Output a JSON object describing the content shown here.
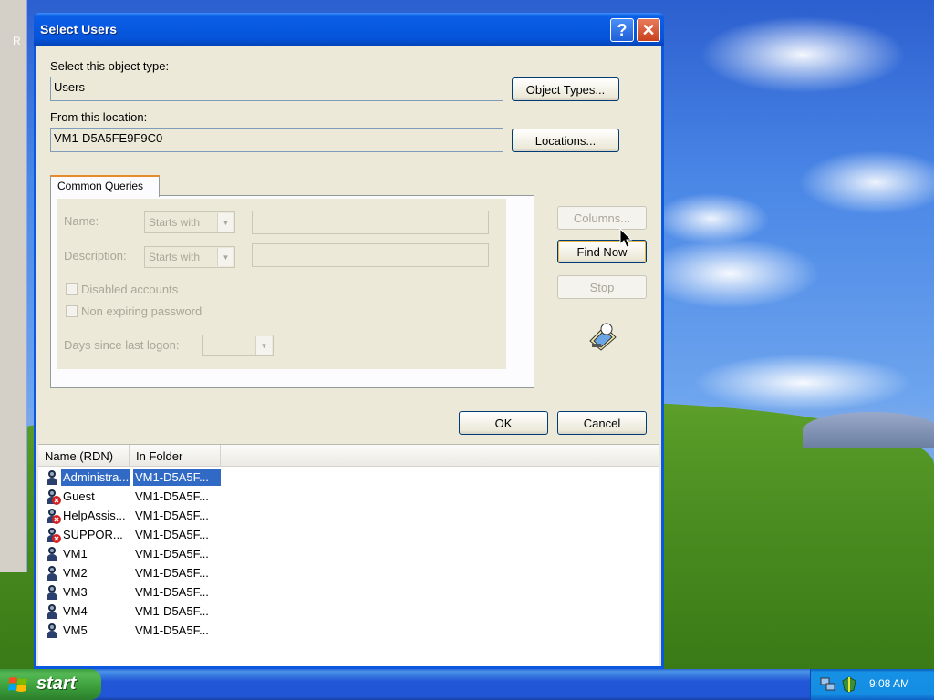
{
  "background_window": {
    "label": "R"
  },
  "dialog": {
    "title": "Select Users",
    "help_label": "?",
    "close_label": "✕",
    "object_type": {
      "label": "Select this object type:",
      "value": "Users",
      "button": "Object Types..."
    },
    "location": {
      "label": "From this location:",
      "value": "VM1-D5A5FE9F9C0",
      "button": "Locations..."
    },
    "tab": {
      "label": "Common Queries"
    },
    "queries": {
      "name_label": "Name:",
      "name_mode": "Starts with",
      "description_label": "Description:",
      "description_mode": "Starts with",
      "disabled_accounts": "Disabled accounts",
      "non_expiring": "Non expiring password",
      "days_label": "Days since last logon:"
    },
    "side_buttons": {
      "columns": "Columns...",
      "find_now": "Find Now",
      "stop": "Stop"
    },
    "ok": "OK",
    "cancel": "Cancel",
    "results": {
      "columns": [
        "Name (RDN)",
        "In Folder"
      ],
      "rows": [
        {
          "name": "Administra...",
          "folder": "VM1-D5A5F...",
          "disabled": false,
          "selected": true
        },
        {
          "name": "Guest",
          "folder": "VM1-D5A5F...",
          "disabled": true,
          "selected": false
        },
        {
          "name": "HelpAssis...",
          "folder": "VM1-D5A5F...",
          "disabled": true,
          "selected": false
        },
        {
          "name": "SUPPOR...",
          "folder": "VM1-D5A5F...",
          "disabled": true,
          "selected": false
        },
        {
          "name": "VM1",
          "folder": "VM1-D5A5F...",
          "disabled": false,
          "selected": false
        },
        {
          "name": "VM2",
          "folder": "VM1-D5A5F...",
          "disabled": false,
          "selected": false
        },
        {
          "name": "VM3",
          "folder": "VM1-D5A5F...",
          "disabled": false,
          "selected": false
        },
        {
          "name": "VM4",
          "folder": "VM1-D5A5F...",
          "disabled": false,
          "selected": false
        },
        {
          "name": "VM5",
          "folder": "VM1-D5A5F...",
          "disabled": false,
          "selected": false
        }
      ]
    }
  },
  "taskbar": {
    "start_label": "start",
    "clock": "9:08 AM"
  },
  "colors": {
    "titlebar": "#0553d9",
    "selection": "#316ac5",
    "start_green": "#3a9d3a",
    "taskbar_blue": "#2157d7"
  },
  "icons": [
    "help-icon",
    "close-icon",
    "search-flashlight-icon",
    "user-icon",
    "disabled-user-icon",
    "windows-flag-icon",
    "network-icon",
    "security-icon",
    "mouse-cursor-icon"
  ]
}
